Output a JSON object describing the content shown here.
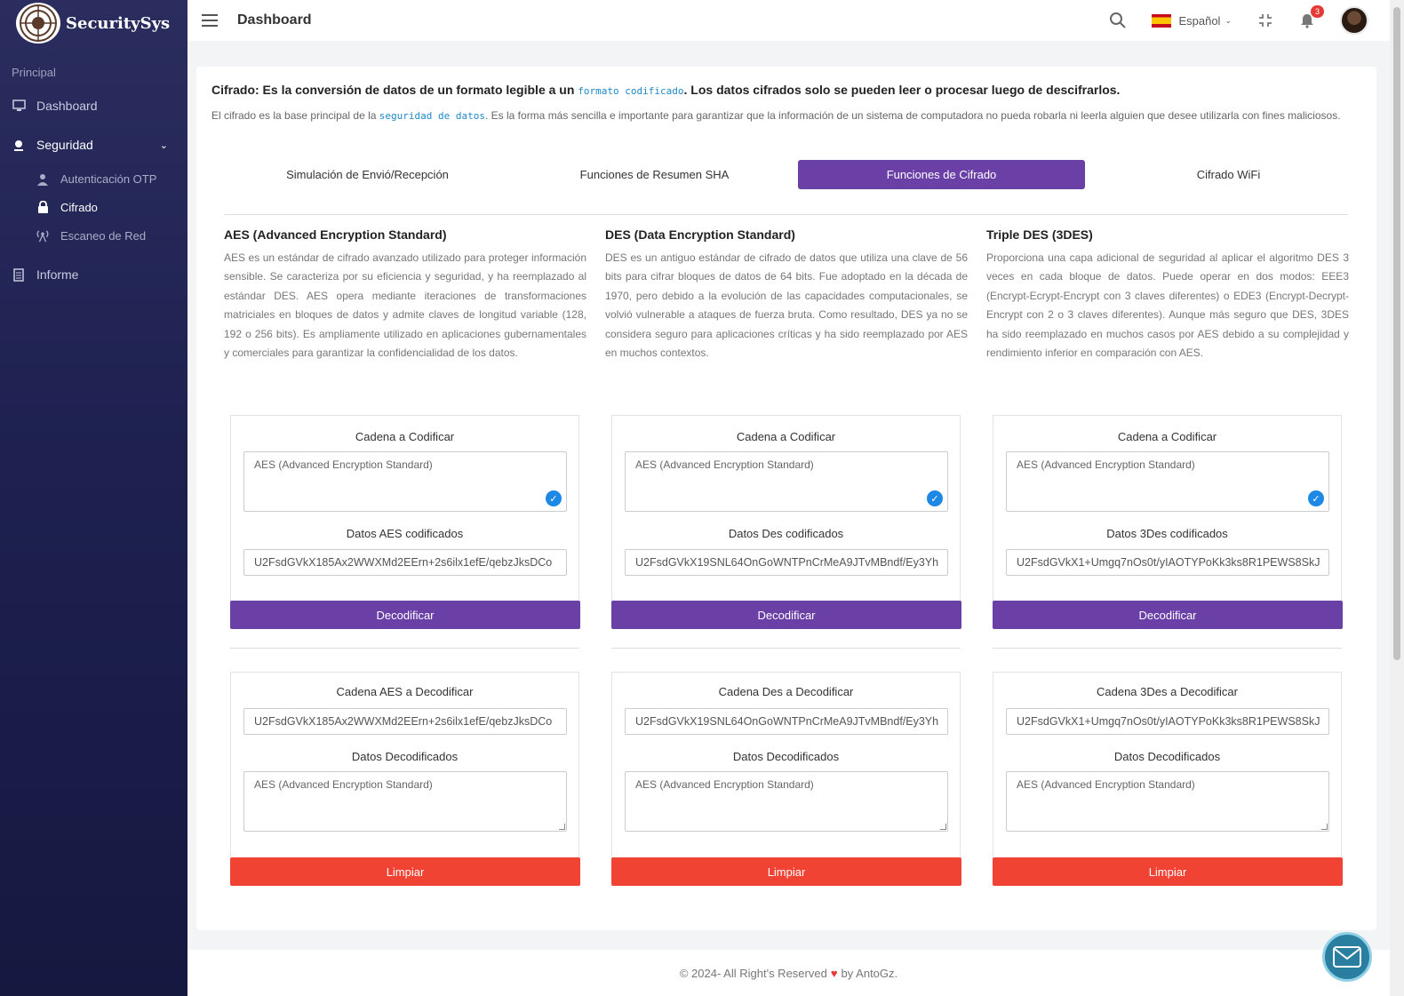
{
  "sidebar": {
    "brand": "SecuritySys",
    "section": "Principal",
    "items": {
      "dashboard": "Dashboard",
      "seguridad": "Seguridad",
      "otp": "Autenticación OTP",
      "cifrado": "Cifrado",
      "escaneo": "Escaneo de Red",
      "informe": "Informe"
    }
  },
  "header": {
    "title": "Dashboard",
    "language": "Español",
    "notifications": "3"
  },
  "intro": {
    "title_pre": "Cifrado: Es la conversión de datos de un formato legible a un ",
    "title_code": "formato codificado",
    "title_post": ". Los datos cifrados solo se pueden leer o procesar luego de descifrarlos.",
    "text_pre": "El cifrado es la base principal de la ",
    "text_code": "seguridad de datos",
    "text_post": ". Es la forma más sencilla e importante para garantizar que la información de un sistema de computadora no pueda robarla ni leerla alguien que desee utilizarla con fines maliciosos."
  },
  "tabs": [
    "Simulación de Envió/Recepción",
    "Funciones de Resumen SHA",
    "Funciones de Cifrado",
    "Cifrado WiFi"
  ],
  "columns": [
    {
      "title": "AES (Advanced Encryption Standard)",
      "text": "AES es un estándar de cifrado avanzado utilizado para proteger información sensible. Se caracteriza por su eficiencia y seguridad, y ha reemplazado al estándar DES. AES opera mediante iteraciones de transformaciones matriciales en bloques de datos y admite claves de longitud variable (128, 192 o 256 bits). Es ampliamente utilizado en aplicaciones gubernamentales y comerciales para garantizar la confidencialidad de los datos.",
      "encode_label": "Cadena a Codificar",
      "encode_value": "AES (Advanced Encryption Standard)",
      "encoded_label": "Datos AES codificados",
      "encoded_value": "U2FsdGVkX185Ax2WWXMd2EErn+2s6ilx1efE/qebzJksDCo",
      "decode_button": "Decodificar",
      "decode_label": "Cadena AES a Decodificar",
      "decode_value": "U2FsdGVkX185Ax2WWXMd2EErn+2s6ilx1efE/qebzJksDCo",
      "decoded_label": "Datos Decodificados",
      "decoded_value": "AES (Advanced Encryption Standard)",
      "clear_button": "Limpiar"
    },
    {
      "title": "DES (Data Encryption Standard)",
      "text": "DES es un antiguo estándar de cifrado de datos que utiliza una clave de 56 bits para cifrar bloques de datos de 64 bits. Fue adoptado en la década de 1970, pero debido a la evolución de las capacidades computacionales, se volvió vulnerable a ataques de fuerza bruta. Como resultado, DES ya no se considera seguro para aplicaciones críticas y ha sido reemplazado por AES en muchos contextos.",
      "encode_label": "Cadena a Codificar",
      "encode_value": "AES (Advanced Encryption Standard)",
      "encoded_label": "Datos Des codificados",
      "encoded_value": "U2FsdGVkX19SNL64OnGoWNTPnCrMeA9JTvMBndf/Ey3Yh",
      "decode_button": "Decodificar",
      "decode_label": "Cadena Des a Decodificar",
      "decode_value": "U2FsdGVkX19SNL64OnGoWNTPnCrMeA9JTvMBndf/Ey3Yh",
      "decoded_label": "Datos Decodificados",
      "decoded_value": "AES (Advanced Encryption Standard)",
      "clear_button": "Limpiar"
    },
    {
      "title": "Triple DES (3DES)",
      "text": "Proporciona una capa adicional de seguridad al aplicar el algoritmo DES 3 veces en cada bloque de datos. Puede operar en dos modos: EEE3 (Encrypt-Ecrypt-Encrypt con 3 claves diferentes) o EDE3 (Encrypt-Decrypt-Encrypt con 2 o 3 claves diferentes). Aunque más seguro que DES, 3DES ha sido reemplazado en muchos casos por AES debido a su complejidad y rendimiento inferior en comparación con AES.",
      "encode_label": "Cadena a Codificar",
      "encode_value": "AES (Advanced Encryption Standard)",
      "encoded_label": "Datos 3Des codificados",
      "encoded_value": "U2FsdGVkX1+Umgq7nOs0t/yIAOTYPoKk3ks8R1PEWS8SkJ",
      "decode_button": "Decodificar",
      "decode_label": "Cadena 3Des a Decodificar",
      "decode_value": "U2FsdGVkX1+Umgq7nOs0t/yIAOTYPoKk3ks8R1PEWS8SkJ",
      "decoded_label": "Datos Decodificados",
      "decoded_value": "AES (Advanced Encryption Standard)",
      "clear_button": "Limpiar"
    }
  ],
  "footer": {
    "pre": "© 2024- All Right's Reserved",
    "post": "by AntoGz."
  },
  "colors": {
    "accent": "#6a3fa6",
    "danger": "#f04334",
    "sidebar": "#1e2150",
    "link": "#1e88c8"
  },
  "icons": {
    "logo": "shield-logo-icon",
    "search": "search-icon",
    "fullscreen": "fullscreen-exit-icon",
    "bell": "bell-icon",
    "mail": "mail-icon"
  }
}
